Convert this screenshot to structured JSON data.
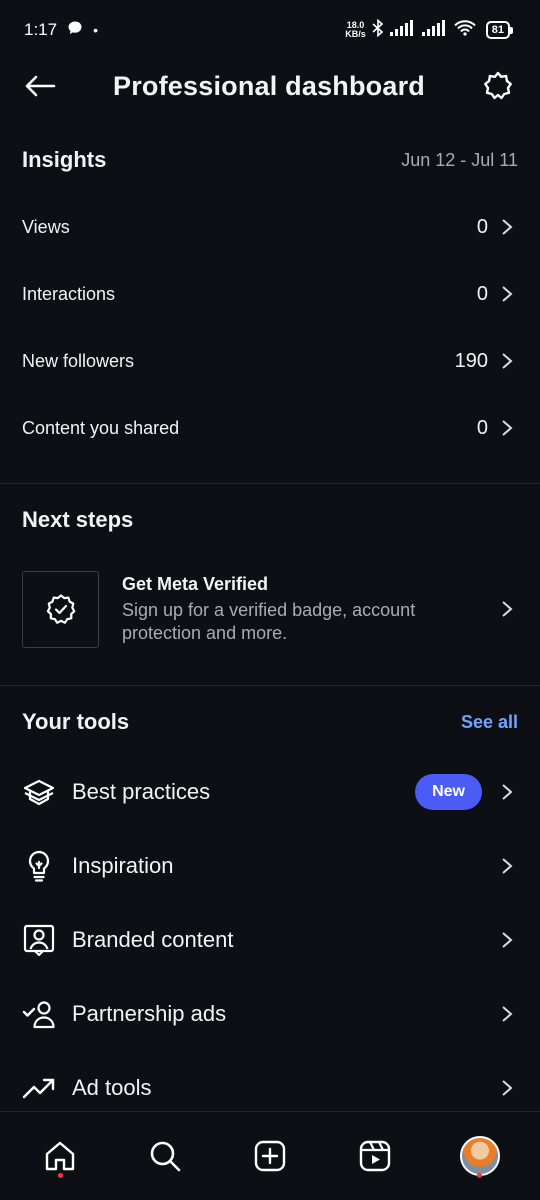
{
  "status_bar": {
    "time": "1:17",
    "net_speed_value": "18.0",
    "net_speed_unit": "KB/s",
    "battery": "81"
  },
  "header": {
    "title": "Professional dashboard"
  },
  "insights": {
    "title": "Insights",
    "date_range": "Jun 12 - Jul 11",
    "rows": [
      {
        "label": "Views",
        "value": "0"
      },
      {
        "label": "Interactions",
        "value": "0"
      },
      {
        "label": "New followers",
        "value": "190"
      },
      {
        "label": "Content you shared",
        "value": "0"
      }
    ]
  },
  "next_steps": {
    "title": "Next steps",
    "card": {
      "title": "Get Meta Verified",
      "description": "Sign up for a verified badge, account protection and more.",
      "icon": "verified-badge-icon"
    }
  },
  "tools": {
    "title": "Your tools",
    "see_all": "See all",
    "items": [
      {
        "label": "Best practices",
        "icon": "graduation-cap-icon",
        "badge": "New"
      },
      {
        "label": "Inspiration",
        "icon": "lightbulb-icon"
      },
      {
        "label": "Branded content",
        "icon": "branded-content-icon"
      },
      {
        "label": "Partnership ads",
        "icon": "partnership-icon"
      },
      {
        "label": "Ad tools",
        "icon": "trending-up-icon"
      }
    ]
  },
  "bottom_nav": {
    "items": [
      "home-icon",
      "search-icon",
      "create-icon",
      "reels-icon",
      "profile-avatar"
    ]
  },
  "colors": {
    "background": "#0d0f14",
    "accent_link": "#6fa4ff",
    "badge": "#4a5cf5",
    "notification_dot": "#ff3040"
  }
}
